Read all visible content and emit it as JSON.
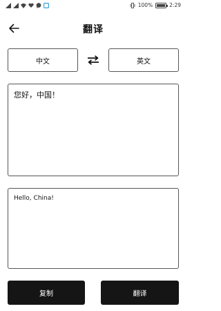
{
  "status_bar": {
    "battery_text": "100%",
    "battery_level": 1.0,
    "time": "2:29",
    "icons": [
      "signal-icon",
      "signal-icon",
      "wifi-icon",
      "heart-icon",
      "chat-icon",
      "screen-icon",
      "vibrate-icon"
    ]
  },
  "header": {
    "title": "翻译",
    "back_icon": "arrow-left-icon"
  },
  "languages": {
    "source": "中文",
    "target": "英文",
    "swap_icon": "swap-arrows-icon"
  },
  "source_text": "您好，中国！",
  "translated_text": "Hello, China!",
  "buttons": {
    "copy": "复制",
    "translate": "翻译"
  },
  "colors": {
    "button_bg": "#151515",
    "border": "#555555"
  }
}
